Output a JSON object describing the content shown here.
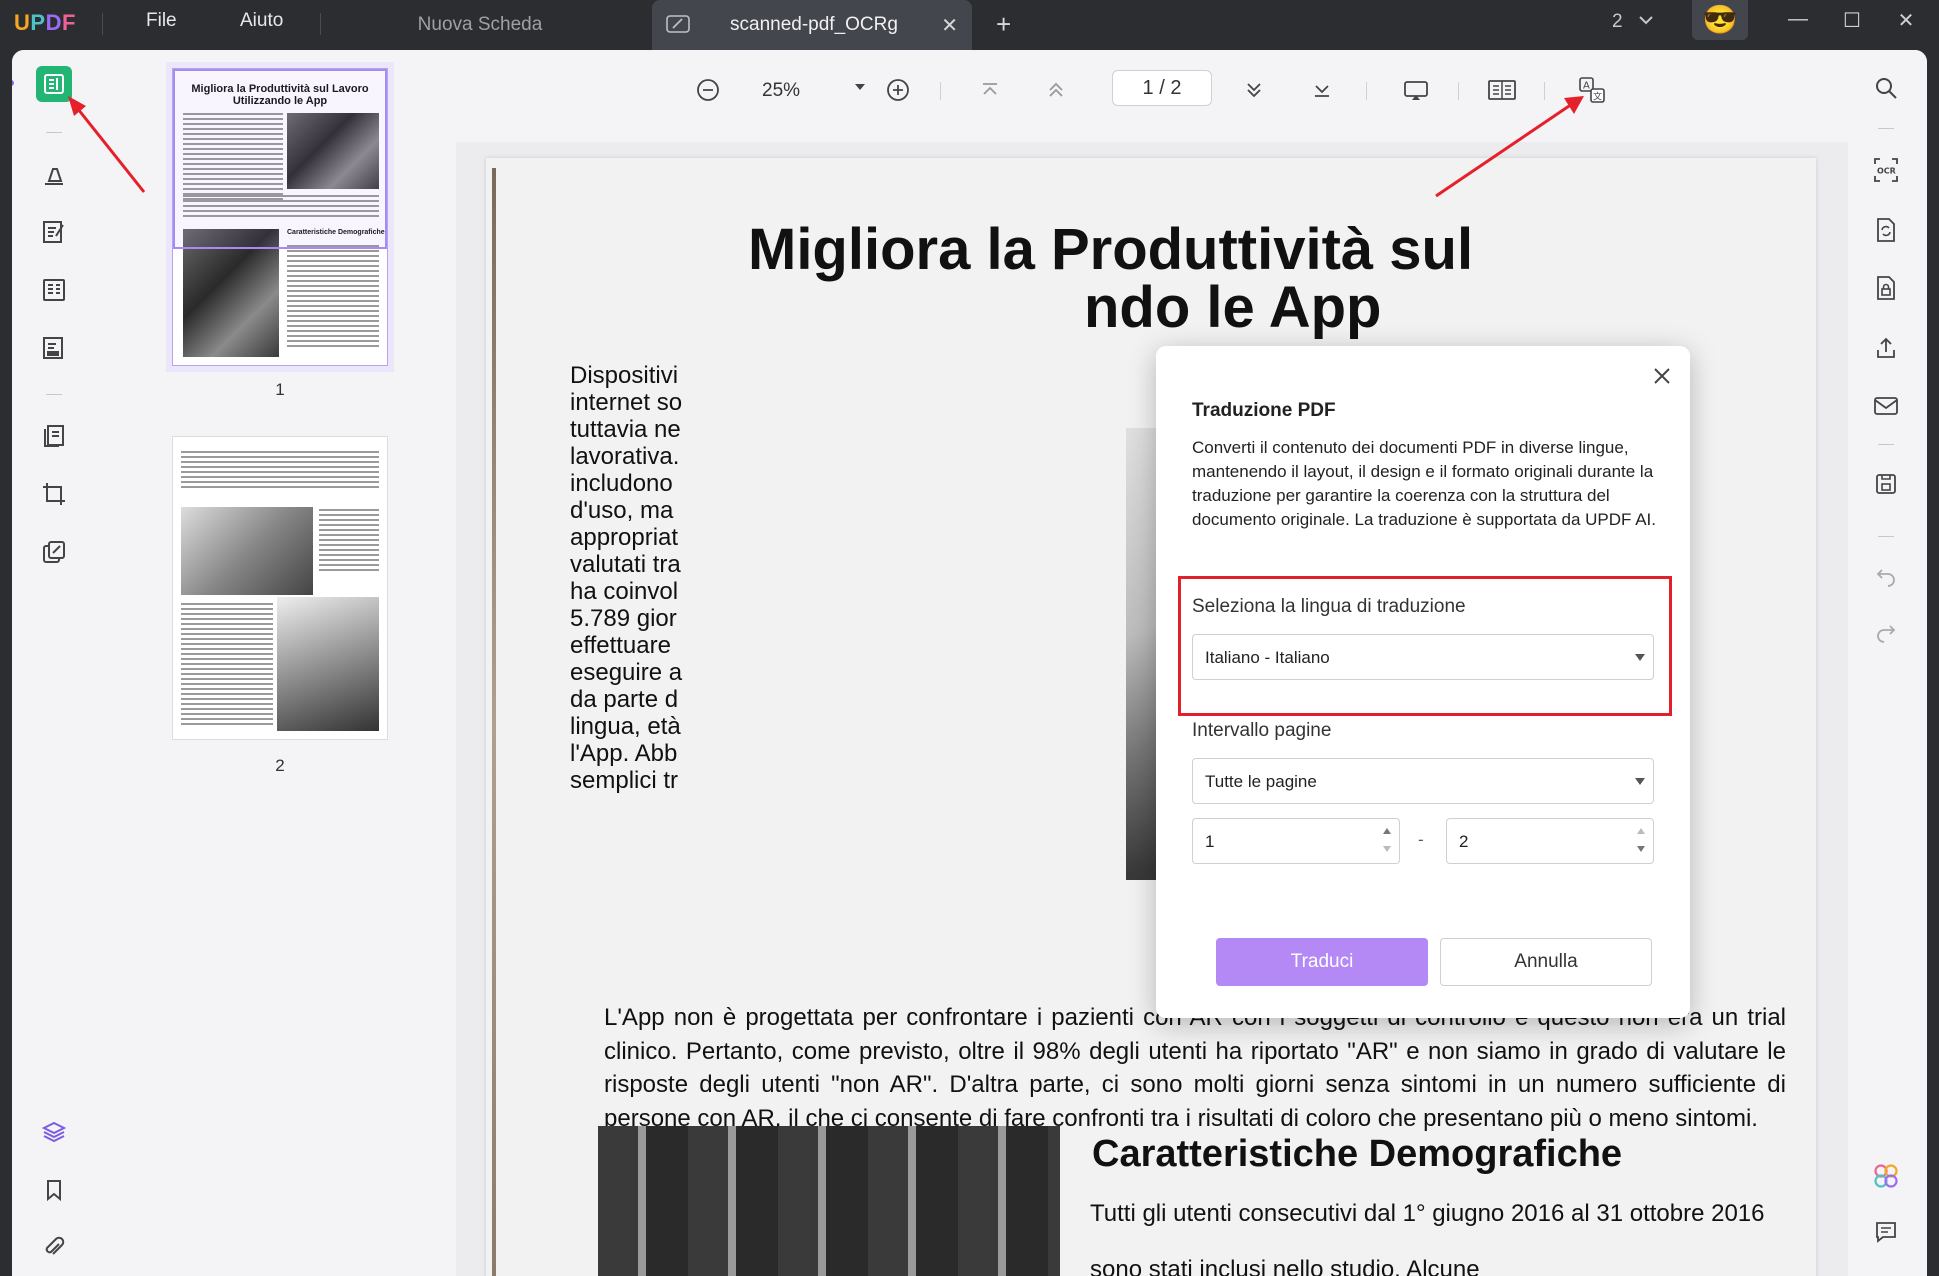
{
  "titlebar": {
    "logo": {
      "u": "U",
      "p": "P",
      "d": "D",
      "f": "F"
    },
    "menu": [
      "File",
      "Aiuto"
    ],
    "tabs": [
      {
        "label": "Nuova Scheda",
        "active": false
      },
      {
        "label": "scanned-pdf_OCRg",
        "active": true
      }
    ],
    "tab_close": "✕",
    "add_tab": "+",
    "tab_count": "2",
    "avatar": "😎",
    "window_controls": {
      "minimize": "—",
      "maximize": "☐",
      "close": "✕"
    }
  },
  "thumbnails": {
    "pages": [
      {
        "number": "1",
        "title": "Migliora la Produttività sul Lavoro Utilizzando le App",
        "section": "Caratteristiche Demografiche"
      },
      {
        "number": "2"
      }
    ]
  },
  "toolbar": {
    "zoom": "25%",
    "page_current": "1",
    "page_total": "2",
    "page_sep": "/"
  },
  "document": {
    "title_line1": "Migliora la Produttività sul",
    "title_line2_visible": "ndo le App",
    "column_lines": [
      "Dispositivi",
      "internet so",
      "tuttavia ne",
      "lavorativa.",
      "includono",
      "d'uso, ma",
      "appropriat",
      "valutati tra",
      "ha coinvol",
      "5.789 gior",
      "effettuare",
      "eseguire a",
      "da parte d",
      "lingua, età",
      "l'App. Abb",
      "semplici tr"
    ],
    "paragraph": "L'App non è progettata per confrontare i pazienti con AR con i soggetti di controllo e questo non era un trial clinico. Pertanto, come previsto, oltre il 98% degli utenti ha riportato \"AR\" e non siamo in grado di valutare le risposte degli utenti \"non AR\". D'altra parte, ci sono molti giorni senza sintomi in un numero sufficiente di persone con AR, il che ci consente di fare confronti tra i risultati di coloro che presentano più o meno sintomi.",
    "section_title": "Caratteristiche Demografiche",
    "section_text": "Tutti gli utenti consecutivi dal 1° giugno 2016 al 31 ottobre 2016 sono stati inclusi nello studio. Alcune"
  },
  "dialog": {
    "title": "Traduzione PDF",
    "description": "Converti il contenuto dei documenti PDF in diverse lingue, mantenendo il layout, il design e il formato originali durante la traduzione per garantire la coerenza con la struttura del documento originale. La traduzione è supportata da UPDF AI.",
    "language_label": "Seleziona la lingua di traduzione",
    "language_value": "Italiano - Italiano",
    "range_label": "Intervallo pagine",
    "range_value": "Tutte le pagine",
    "range_from": "1",
    "range_to": "2",
    "range_dash": "-",
    "translate_button": "Traduci",
    "cancel_button": "Annulla"
  },
  "colors": {
    "accent": "#22b573",
    "primary_button": "#b489f5",
    "highlight_box": "#e0202a",
    "titlebar": "#2b2d31"
  }
}
